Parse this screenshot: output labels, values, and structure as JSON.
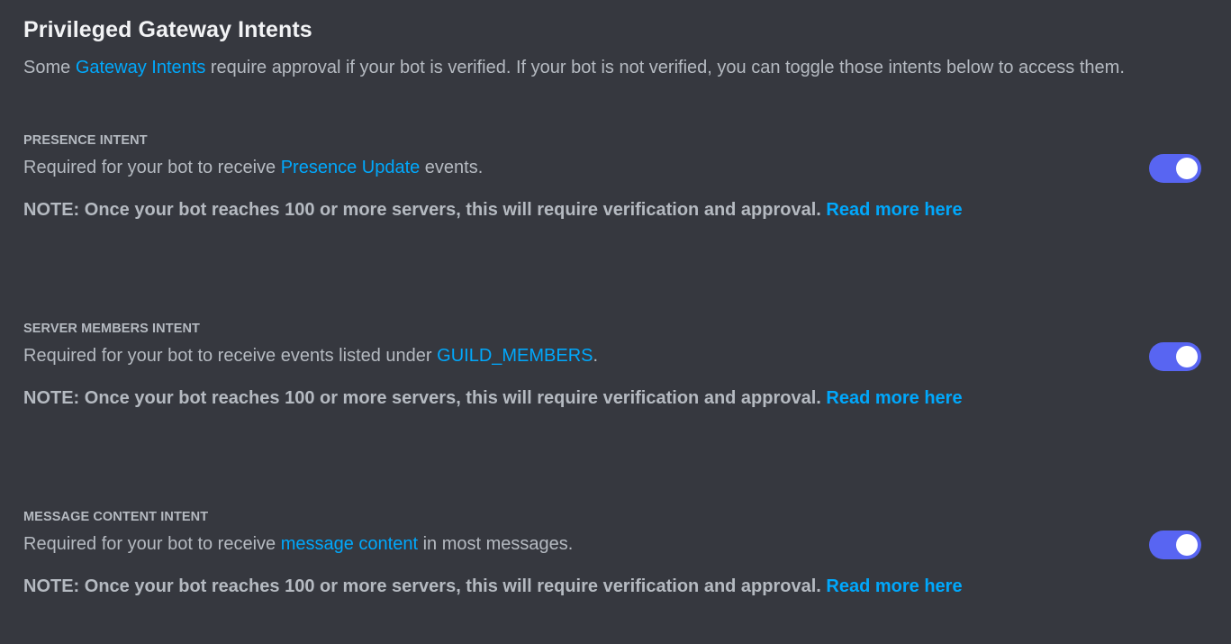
{
  "header": {
    "title": "Privileged Gateway Intents",
    "subtitle_prefix": "Some ",
    "subtitle_link": "Gateway Intents",
    "subtitle_suffix": " require approval if your bot is verified. If your bot is not verified, you can toggle those intents below to access them."
  },
  "colors": {
    "background": "#36383f",
    "link": "#00a8fc",
    "toggle_on": "#5865f2"
  },
  "intents": [
    {
      "heading": "PRESENCE INTENT",
      "desc_prefix": "Required for your bot to receive ",
      "desc_link": "Presence Update",
      "desc_suffix": " events.",
      "note": "NOTE: Once your bot reaches 100 or more servers, this will require verification and approval. ",
      "note_link": "Read more here",
      "enabled": true
    },
    {
      "heading": "SERVER MEMBERS INTENT",
      "desc_prefix": "Required for your bot to receive events listed under ",
      "desc_link": "GUILD_MEMBERS",
      "desc_suffix": ".",
      "note": "NOTE: Once your bot reaches 100 or more servers, this will require verification and approval. ",
      "note_link": "Read more here",
      "enabled": true
    },
    {
      "heading": "MESSAGE CONTENT INTENT",
      "desc_prefix": "Required for your bot to receive ",
      "desc_link": "message content",
      "desc_suffix": " in most messages.",
      "note": "NOTE: Once your bot reaches 100 or more servers, this will require verification and approval. ",
      "note_link": "Read more here",
      "enabled": true
    }
  ]
}
